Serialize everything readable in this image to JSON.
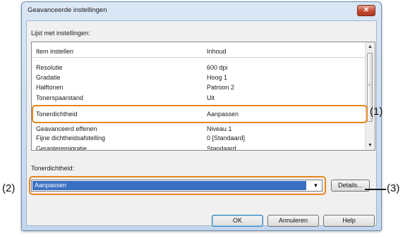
{
  "window": {
    "title": "Geavanceerde instellingen",
    "close_glyph": "✕"
  },
  "settings_list": {
    "label": "Lijst met instellingen:",
    "columns": [
      "Item instellen",
      "Inhoud"
    ],
    "rows": [
      {
        "item": "Resolutie",
        "value": "600 dpi"
      },
      {
        "item": "Gradatie",
        "value": "Hoog 1"
      },
      {
        "item": "Halftonen",
        "value": "Patroon 2"
      },
      {
        "item": "Tonerspaarstand",
        "value": "Uit"
      },
      {
        "item": "Tonerdichtheid",
        "value": "Aanpassen"
      },
      {
        "item": "Geavanceerd effenen",
        "value": "Niveau 1"
      },
      {
        "item": "Fijne dichtheidsafstelling",
        "value": "0 [Standaard]"
      },
      {
        "item": "Gerasteremigratie",
        "value": "Standaard"
      }
    ],
    "scroll_up_glyph": "▲",
    "scroll_down_glyph": "▼"
  },
  "setting": {
    "label": "Tonerdichtheid:",
    "selected_value": "Aanpassen",
    "dropdown_glyph": "▼",
    "details_label": "Details..."
  },
  "buttons": {
    "ok": "OK",
    "cancel": "Annuleren",
    "help": "Help"
  },
  "callouts": {
    "one": "(1)",
    "two": "(2)",
    "three": "(3)"
  },
  "icons": {
    "close": "close-icon",
    "dropdown": "chevron-down-icon",
    "scroll_up": "arrow-up-icon",
    "scroll_down": "arrow-down-icon"
  },
  "colors": {
    "highlight": "#e5871f",
    "selection": "#3a70c4",
    "titlebar": "#c3d7ee",
    "close": "#c24a31"
  }
}
